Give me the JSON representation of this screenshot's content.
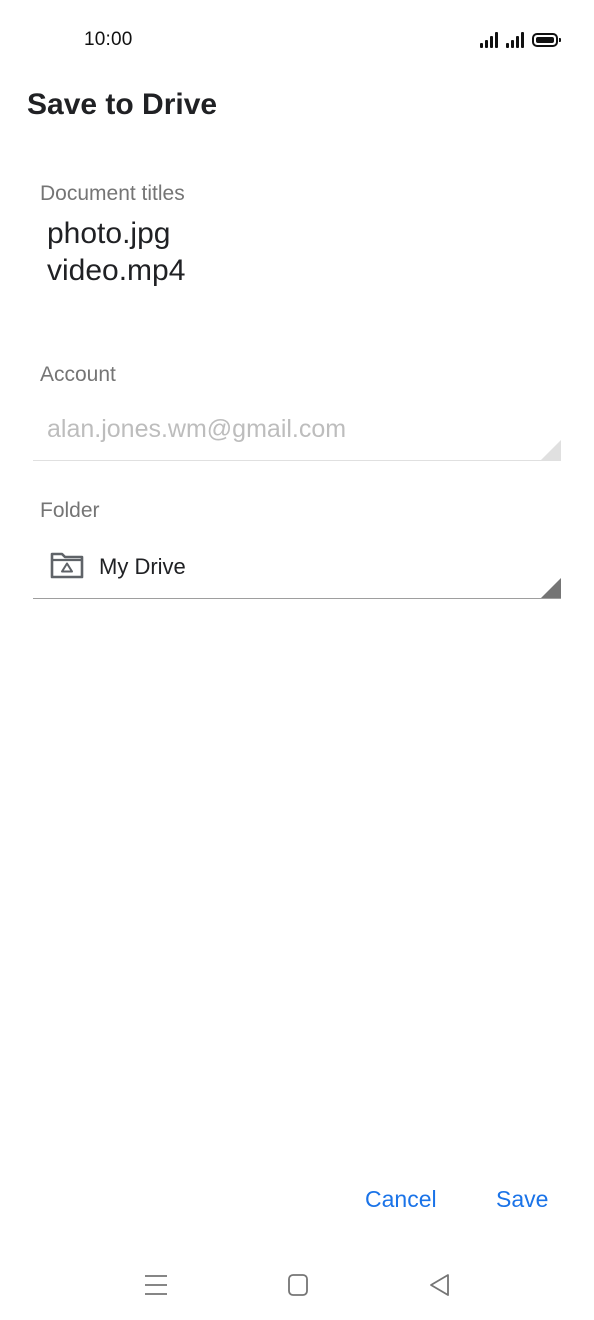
{
  "status_bar": {
    "time": "10:00",
    "icons": [
      "signal-icon",
      "signal-icon",
      "battery-icon"
    ]
  },
  "header": {
    "title": "Save to Drive"
  },
  "document_titles": {
    "label": "Document titles",
    "items": [
      "photo.jpg",
      "video.mp4"
    ]
  },
  "account": {
    "label": "Account",
    "value": "alan.jones.wm@gmail.com"
  },
  "folder": {
    "label": "Folder",
    "value": "My Drive",
    "icon": "drive-folder-icon"
  },
  "actions": {
    "cancel_label": "Cancel",
    "save_label": "Save"
  },
  "navigation": {
    "icons": [
      "menu-icon",
      "home-icon",
      "back-icon"
    ]
  },
  "colors": {
    "accent": "#1a73e8",
    "text_primary": "#202124",
    "text_secondary": "#757575",
    "text_disabled": "#bdbdbd"
  }
}
